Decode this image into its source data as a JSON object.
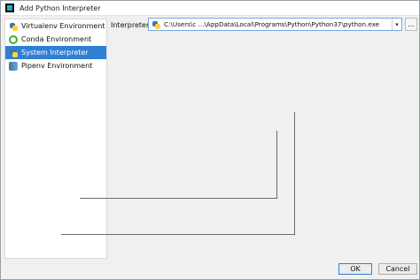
{
  "window": {
    "title": "Add Python Interpreter"
  },
  "sidebar": {
    "items": [
      {
        "label": "Virtualenv Environment",
        "icon": "python-icon",
        "selected": false
      },
      {
        "label": "Conda Environment",
        "icon": "conda-icon",
        "selected": false
      },
      {
        "label": "System Interpreter",
        "icon": "python-icon",
        "selected": true
      },
      {
        "label": "Pipenv Environment",
        "icon": "pipenv-icon",
        "selected": false
      }
    ]
  },
  "interpreter": {
    "label": "Interpreter:",
    "value": "C:\\Users\\c ...\\AppData\\Local\\Programs\\Python\\Python37\\python.exe",
    "browse_label": "..."
  },
  "buttons": {
    "ok_label": "OK",
    "cancel_label": "Cancel"
  },
  "colors": {
    "selection": "#2f7fd6",
    "accent_border": "#7aa7dd"
  }
}
